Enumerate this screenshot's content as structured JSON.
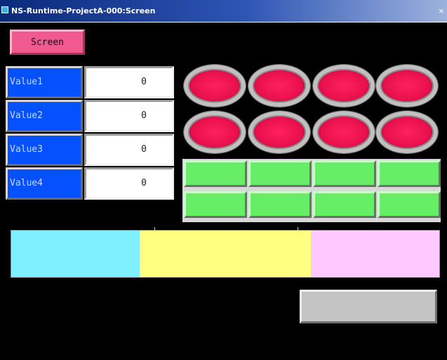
{
  "window": {
    "title": "NS-Runtime-ProjectA-000:Screen",
    "close_glyph": "×"
  },
  "screen_button": {
    "label": "Screen"
  },
  "values": [
    {
      "label": "Value1",
      "value": "0"
    },
    {
      "label": "Value2",
      "value": "0"
    },
    {
      "label": "Value3",
      "value": "0"
    },
    {
      "label": "Value4",
      "value": "0"
    }
  ],
  "lamps": {
    "count": 8,
    "color": "#e8104c",
    "ring": "#c0c0c0"
  },
  "green_buttons": {
    "count": 8,
    "color": "#66ee66"
  },
  "color_bar": {
    "segments": [
      {
        "name": "cyan",
        "color": "#7ff0ff",
        "fraction": 0.3
      },
      {
        "name": "yellow",
        "color": "#ffff80",
        "fraction": 0.4
      },
      {
        "name": "pink",
        "color": "#ffc8ff",
        "fraction": 0.3
      }
    ]
  },
  "gray_button": {
    "label": ""
  },
  "icons": {
    "window_icon": "app-window-icon",
    "close": "close-icon"
  }
}
